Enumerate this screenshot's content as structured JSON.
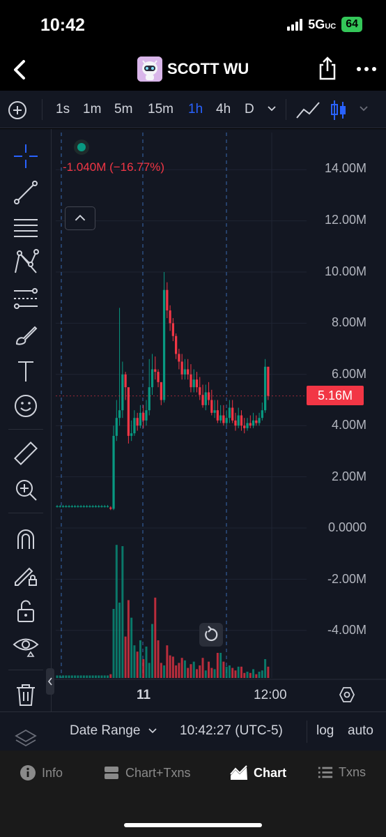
{
  "status_bar": {
    "time": "10:42",
    "network": "5G",
    "network_suffix": "UC",
    "battery": "64"
  },
  "header": {
    "token_name": "SCOTT WU"
  },
  "timeframes": {
    "items": [
      "1s",
      "1m",
      "5m",
      "15m",
      "1h",
      "4h",
      "D"
    ],
    "active": "1h"
  },
  "chart": {
    "price_change": "-1.040M (−16.77%)",
    "last_price": "5.16M",
    "y_ticks": [
      "14.00M",
      "12.00M",
      "10.00M",
      "8.00M",
      "6.00M",
      "4.00M",
      "2.00M",
      "0.0000",
      "-2.00M",
      "-4.00M"
    ],
    "x_ticks": {
      "day": "11",
      "time": "12:00"
    },
    "colors": {
      "up": "#089981",
      "down": "#f23645",
      "background": "#131722",
      "accent": "#2962ff"
    }
  },
  "chart_data": {
    "type": "candlestick",
    "ylim": [
      -5.5,
      14.5
    ],
    "yunit": "M",
    "ticks": [
      14,
      12,
      10,
      8,
      6,
      4,
      2,
      0,
      -2,
      -4
    ],
    "x_ticks": [
      "11",
      "12:00"
    ],
    "open": [
      0.85,
      0.85,
      0.85,
      0.85,
      0.85,
      0.85,
      0.85,
      0.85,
      0.85,
      0.85,
      0.85,
      0.85,
      0.85,
      0.85,
      0.85,
      0.85,
      0.85,
      0.85,
      0.8,
      0.75,
      3.6,
      4.3,
      4.6,
      6.0,
      5.5,
      3.6,
      3.7,
      4.3,
      4.0,
      4.5,
      4.2,
      4.6,
      5.5,
      6.2,
      6.1,
      5.7,
      5.0,
      9.3,
      8.5,
      8.0,
      7.5,
      6.8,
      6.5,
      6.0,
      6.2,
      6.0,
      5.5,
      5.8,
      5.5,
      5.2,
      4.8,
      5.3,
      5.0,
      4.5,
      4.6,
      4.2,
      4.4,
      4.1,
      4.3,
      4.7,
      4.2,
      4.0,
      4.4,
      4.0,
      3.9,
      4.1,
      4.0,
      4.2,
      4.1,
      4.3,
      4.6,
      6.3
    ],
    "close": [
      0.85,
      0.85,
      0.85,
      0.85,
      0.85,
      0.85,
      0.85,
      0.85,
      0.85,
      0.85,
      0.85,
      0.85,
      0.85,
      0.85,
      0.85,
      0.85,
      0.85,
      0.85,
      0.75,
      3.6,
      4.3,
      4.6,
      6.0,
      5.5,
      3.6,
      3.7,
      4.3,
      4.0,
      4.5,
      4.2,
      4.6,
      5.5,
      6.2,
      6.1,
      5.7,
      5.0,
      9.3,
      8.5,
      8.0,
      7.5,
      6.8,
      6.5,
      6.0,
      6.2,
      6.0,
      5.5,
      5.8,
      5.5,
      5.2,
      4.8,
      5.3,
      5.0,
      4.5,
      4.6,
      4.2,
      4.4,
      4.1,
      4.3,
      4.7,
      4.2,
      4.0,
      4.4,
      4.0,
      3.9,
      4.1,
      4.0,
      4.2,
      4.1,
      4.3,
      4.6,
      6.3,
      5.16
    ],
    "high": [
      0.9,
      0.9,
      0.9,
      0.9,
      0.9,
      0.9,
      0.9,
      0.9,
      0.9,
      0.9,
      0.9,
      0.9,
      0.9,
      0.9,
      0.9,
      0.9,
      0.9,
      0.9,
      0.85,
      4.0,
      5.0,
      8.6,
      6.5,
      6.1,
      4.0,
      4.2,
      4.6,
      4.5,
      4.8,
      4.8,
      5.0,
      6.6,
      6.8,
      6.7,
      6.2,
      5.6,
      10.0,
      9.6,
      8.7,
      8.2,
      7.6,
      7.0,
      6.8,
      6.6,
      6.6,
      6.4,
      6.2,
      6.1,
      5.9,
      5.6,
      5.6,
      5.7,
      5.4,
      5.0,
      5.0,
      4.8,
      4.8,
      4.6,
      5.0,
      5.0,
      4.5,
      4.7,
      4.6,
      4.3,
      4.3,
      4.4,
      4.5,
      4.4,
      4.5,
      4.9,
      6.6,
      6.3
    ],
    "low": [
      0.8,
      0.8,
      0.8,
      0.8,
      0.8,
      0.8,
      0.8,
      0.8,
      0.8,
      0.8,
      0.8,
      0.8,
      0.8,
      0.8,
      0.8,
      0.8,
      0.8,
      0.8,
      0.7,
      0.7,
      3.4,
      4.0,
      4.3,
      5.0,
      3.3,
      3.4,
      3.6,
      3.8,
      3.9,
      3.9,
      4.0,
      4.4,
      5.2,
      5.8,
      5.5,
      4.8,
      4.9,
      8.2,
      7.7,
      7.3,
      6.6,
      6.2,
      5.8,
      5.8,
      5.8,
      5.3,
      5.3,
      5.3,
      5.0,
      4.7,
      4.6,
      4.8,
      4.4,
      4.3,
      4.1,
      4.1,
      4.0,
      4.0,
      4.1,
      4.1,
      3.8,
      3.9,
      3.8,
      3.7,
      3.8,
      3.9,
      3.9,
      4.0,
      4.0,
      4.2,
      4.5,
      5.0
    ],
    "volume": [
      0.2,
      0.2,
      0.2,
      0.2,
      0.2,
      0.2,
      0.2,
      0.2,
      0.2,
      0.2,
      0.2,
      0.2,
      0.2,
      0.2,
      0.2,
      0.2,
      0.2,
      0.2,
      0.3,
      5.5,
      10.6,
      6.0,
      10.5,
      3.3,
      6.2,
      4.8,
      2.6,
      2.1,
      3.0,
      1.5,
      2.5,
      1.2,
      4.3,
      6.4,
      3.0,
      1.2,
      1.0,
      2.6,
      1.8,
      1.7,
      1.0,
      1.2,
      1.6,
      1.4,
      0.8,
      1.1,
      1.3,
      0.7,
      1.0,
      1.6,
      0.6,
      1.3,
      0.8,
      0.7,
      2.0,
      2.0,
      1.3,
      0.9,
      1.0,
      0.8,
      0.6,
      0.9,
      0.9,
      0.4,
      0.5,
      0.4,
      0.7,
      0.3,
      0.5,
      0.6,
      1.5,
      0.9
    ]
  },
  "range_bar": {
    "date_range": "Date Range",
    "clock": "10:42:27 (UTC-5)",
    "log": "log",
    "auto": "auto"
  },
  "tabs": [
    {
      "label": "Info",
      "icon": "info-icon"
    },
    {
      "label": "Chart+Txns",
      "icon": "chart-txns-icon"
    },
    {
      "label": "Chart",
      "icon": "area-chart-icon",
      "active": true
    },
    {
      "label": "Txns",
      "icon": "list-icon"
    }
  ]
}
